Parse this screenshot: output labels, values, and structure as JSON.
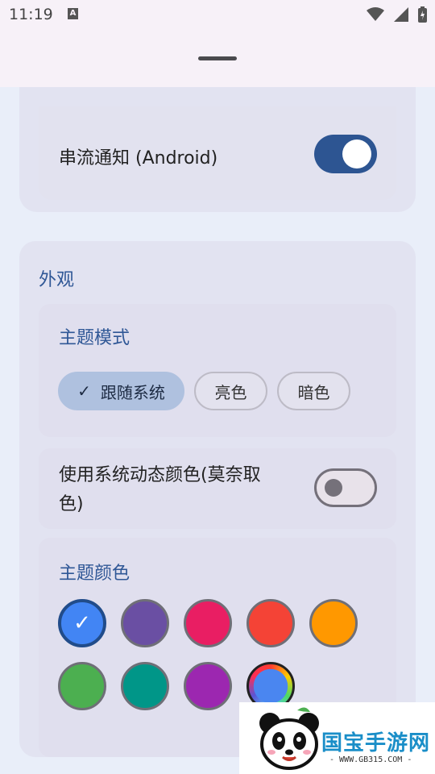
{
  "status_bar": {
    "time": "11:19",
    "a_icon": "A"
  },
  "streaming": {
    "label": "串流通知 (Android)",
    "enabled": true
  },
  "appearance": {
    "section_title": "外观",
    "theme_mode": {
      "title": "主题模式",
      "options": [
        "跟随系统",
        "亮色",
        "暗色"
      ],
      "selected": "跟随系统"
    },
    "dynamic_color": {
      "label_line1": "使用系统动态颜色(莫奈取",
      "label_line2": "色)",
      "enabled": false
    },
    "theme_color": {
      "title": "主题颜色",
      "colors": [
        "#4285f4",
        "#6a4fa3",
        "#e91e63",
        "#f44336",
        "#ff9800",
        "#4caf50",
        "#009688",
        "#9c27b0",
        "#4a86f0"
      ],
      "selected_index": 0
    }
  },
  "watermark": {
    "text": "国宝手游网",
    "url": "- WWW.GB315.COM -"
  }
}
